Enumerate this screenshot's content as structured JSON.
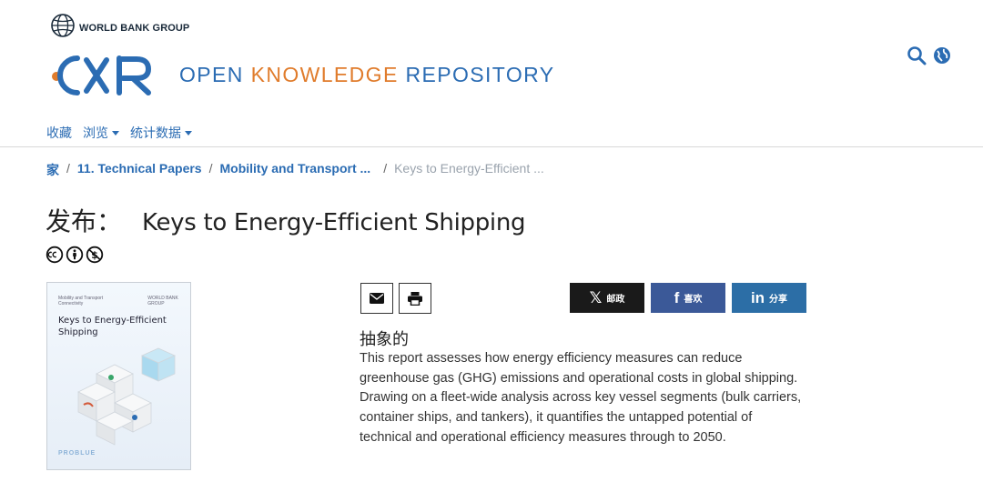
{
  "header": {
    "org_name": "WORLD BANK GROUP",
    "logo_text": "OKR",
    "repo_title_part1": "OPEN ",
    "repo_title_part2": "KNOWLEDGE",
    "repo_title_part3": " REPOSITORY"
  },
  "nav": {
    "items": [
      {
        "label": "收藏",
        "dropdown": false
      },
      {
        "label": "浏览",
        "dropdown": true
      },
      {
        "label": "统计数据",
        "dropdown": true
      }
    ]
  },
  "breadcrumb": {
    "home": "家",
    "sep": "/",
    "items": [
      "11. Technical Papers",
      "Mobility and Transport ..."
    ],
    "current": "Keys to Energy-Efficient ..."
  },
  "page": {
    "title_label": "发布：",
    "title": "Keys to Energy-Efficient Shipping"
  },
  "cover": {
    "header_left": "Mobility and Transport Connectivity",
    "header_right": "WORLD BANK GROUP",
    "title_line1": "Keys to Energy-Efficient",
    "title_line2": "Shipping",
    "footer": "PROBLUE"
  },
  "share": {
    "x_label": "邮政",
    "facebook_label": "喜欢",
    "linkedin_label": "分享",
    "x_glyph": "𝕏",
    "facebook_glyph": "f",
    "linkedin_glyph": "in",
    "colors": {
      "x": "#1a1a1a",
      "facebook": "#3b5998",
      "linkedin": "#2c6ea6"
    }
  },
  "abstract": {
    "heading": "抽象的",
    "text": "This report assesses how energy efficiency measures can reduce greenhouse gas (GHG) emissions and operational costs in global shipping. Drawing on a fleet-wide analysis across key vessel segments (bulk carriers, container ships, and tankers), it quantifies the untapped potential of technical and operational efficiency measures through to 2050."
  },
  "colors": {
    "brand_blue": "#2b6cb3",
    "brand_orange": "#e07c2c"
  },
  "icons": [
    "globe-logo-icon",
    "search-icon",
    "language-globe-icon",
    "cc-icon",
    "by-icon",
    "nc-icon",
    "email-icon",
    "print-icon"
  ]
}
